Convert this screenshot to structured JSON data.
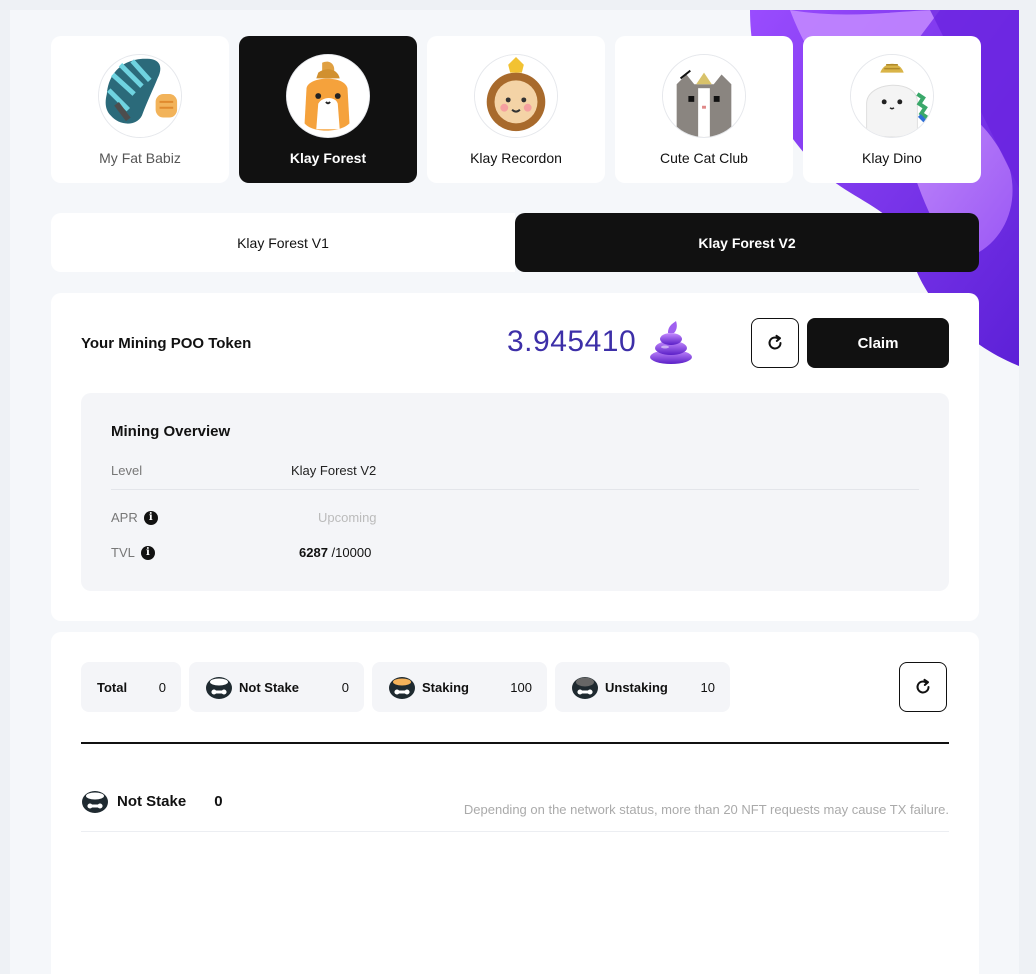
{
  "collections": [
    {
      "name": "My Fat Babiz",
      "icon": "my-fat-babiz-avatar",
      "active": false
    },
    {
      "name": "Klay Forest",
      "icon": "klay-forest-avatar",
      "active": true
    },
    {
      "name": "Klay Recordon",
      "icon": "klay-recordon-avatar",
      "active": false
    },
    {
      "name": "Cute Cat Club",
      "icon": "cute-cat-club-avatar",
      "active": false
    },
    {
      "name": "Klay Dino",
      "icon": "klay-dino-avatar",
      "active": false
    }
  ],
  "versions": {
    "v1": "Klay Forest V1",
    "v2": "Klay Forest V2",
    "active": "v2"
  },
  "mining": {
    "label": "Your Mining POO Token",
    "amount": "3.945410",
    "token_icon": "poo-token-icon",
    "claim_label": "Claim",
    "overview": {
      "title": "Mining Overview",
      "level_label": "Level",
      "level_value": "Klay Forest V2",
      "apr_label": "APR",
      "apr_value": "Upcoming",
      "tvl_label": "TVL",
      "tvl_value": "6287",
      "tvl_max": "/10000"
    }
  },
  "staking": {
    "chips": [
      {
        "label": "Total",
        "count": "0"
      },
      {
        "label": "Not Stake",
        "count": "0"
      },
      {
        "label": "Staking",
        "count": "100"
      },
      {
        "label": "Unstaking",
        "count": "10"
      }
    ],
    "section_label": "Not Stake",
    "section_count": "0",
    "notice": "Depending on the network status, more than 20 NFT requests may cause TX failure."
  },
  "colors": {
    "accent_purple": "#3d2fa8",
    "blob_purple": "#7b2ff7",
    "dark": "#111111"
  }
}
